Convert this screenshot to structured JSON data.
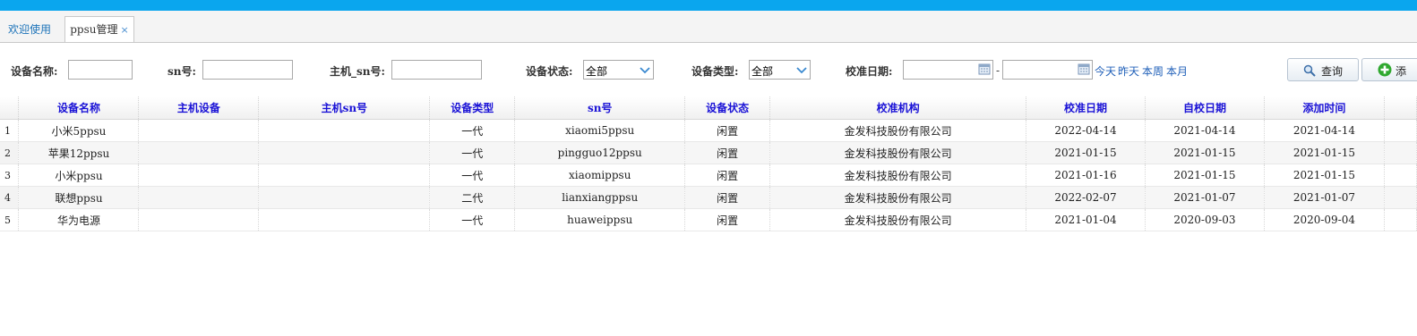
{
  "tabs": [
    {
      "label": "欢迎使用"
    },
    {
      "label": "ppsu管理",
      "close": "×"
    }
  ],
  "search": {
    "device_name_label": "设备名称:",
    "device_name_value": "",
    "sn_label": "sn号:",
    "sn_value": "",
    "host_sn_label": "主机_sn号:",
    "host_sn_value": "",
    "status_label": "设备状态:",
    "status_value": "全部",
    "type_label": "设备类型:",
    "type_value": "全部",
    "calib_date_label": "校准日期:",
    "date_from": "",
    "date_separator": "-",
    "date_to": "",
    "quick_today": "今天",
    "quick_yesterday": "昨天",
    "quick_week": "本周",
    "quick_month": "本月"
  },
  "toolbar": {
    "query_label": "查询",
    "add_label": "添"
  },
  "icons": {
    "query": "search-icon",
    "add": "plus-icon",
    "calendar": "calendar-icon",
    "dropdown": "chevron-down-icon"
  },
  "colors": {
    "topbar": "#0aa6ee",
    "header_text": "#1a12d6",
    "link": "#1f5fb8",
    "add_icon": "#2fa82f"
  },
  "table": {
    "columns": [
      "设备名称",
      "主机设备",
      "主机sn号",
      "设备类型",
      "sn号",
      "设备状态",
      "校准机构",
      "校准日期",
      "自校日期",
      "添加时间"
    ],
    "rows": [
      {
        "num": "1",
        "cells": [
          "小米5ppsu",
          "",
          "",
          "一代",
          "xiaomi5ppsu",
          "闲置",
          "金发科技股份有限公司",
          "2022-04-14",
          "2021-04-14",
          "2021-04-14"
        ]
      },
      {
        "num": "2",
        "cells": [
          "苹果12ppsu",
          "",
          "",
          "一代",
          "pingguo12ppsu",
          "闲置",
          "金发科技股份有限公司",
          "2021-01-15",
          "2021-01-15",
          "2021-01-15"
        ]
      },
      {
        "num": "3",
        "cells": [
          "小米ppsu",
          "",
          "",
          "一代",
          "xiaomippsu",
          "闲置",
          "金发科技股份有限公司",
          "2021-01-16",
          "2021-01-15",
          "2021-01-15"
        ]
      },
      {
        "num": "4",
        "cells": [
          "联想ppsu",
          "",
          "",
          "二代",
          "lianxiangppsu",
          "闲置",
          "金发科技股份有限公司",
          "2022-02-07",
          "2021-01-07",
          "2021-01-07"
        ]
      },
      {
        "num": "5",
        "cells": [
          "华为电源",
          "",
          "",
          "一代",
          "huaweippsu",
          "闲置",
          "金发科技股份有限公司",
          "2021-01-04",
          "2020-09-03",
          "2020-09-04"
        ]
      }
    ]
  }
}
